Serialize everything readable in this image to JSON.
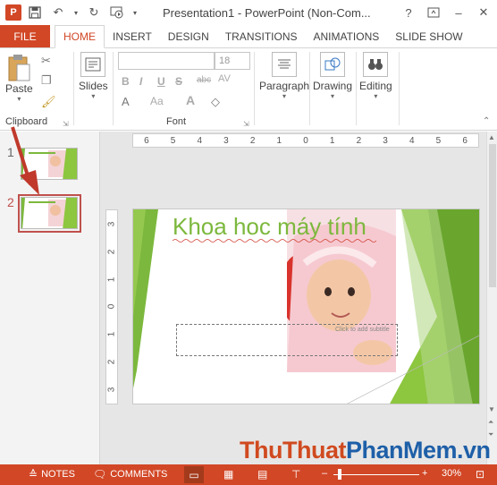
{
  "titlebar": {
    "title": "Presentation1 - PowerPoint (Non-Com...",
    "app_icon_letter": "P",
    "qat": [
      "save-icon",
      "undo-icon",
      "redo-icon",
      "start-from-beginning-icon"
    ],
    "help": "?",
    "minimize": "–",
    "close": "✕"
  },
  "tabs": [
    {
      "label": "FILE"
    },
    {
      "label": "HOME"
    },
    {
      "label": "INSERT"
    },
    {
      "label": "DESIGN"
    },
    {
      "label": "TRANSITIONS"
    },
    {
      "label": "ANIMATIONS"
    },
    {
      "label": "SLIDE SHOW"
    }
  ],
  "ribbon": {
    "clipboard": {
      "paste": "Paste",
      "group": "Clipboard"
    },
    "slides": {
      "label": "Slides"
    },
    "font": {
      "size": "18",
      "group": "Font",
      "buttons": [
        "B",
        "I",
        "U",
        "S",
        "abc",
        "AV",
        "Aa",
        "A"
      ]
    },
    "paragraph": {
      "label": "Paragraph"
    },
    "drawing": {
      "label": "Drawing"
    },
    "editing": {
      "label": "Editing"
    }
  },
  "thumbnails": [
    {
      "number": "1"
    },
    {
      "number": "2"
    }
  ],
  "rulers": {
    "horizontal": [
      "6",
      "5",
      "4",
      "3",
      "2",
      "1",
      "0",
      "1",
      "2",
      "3",
      "4",
      "5",
      "6"
    ],
    "vertical": [
      "3",
      "2",
      "1",
      "0",
      "1",
      "2",
      "3"
    ]
  },
  "slide": {
    "title": "Khoa hoc máy tính",
    "subtitle_placeholder": "Click to add subtitle"
  },
  "statusbar": {
    "notes": "NOTES",
    "comments": "COMMENTS",
    "zoom": "30%",
    "zoom_level": 30,
    "minus": "–",
    "plus": "+"
  },
  "watermark": {
    "part1": "Thu",
    "part2": "Thuat",
    "part3": "PhanMem",
    "part4": ".vn"
  },
  "colors": {
    "accent": "#d24726",
    "title_green": "#7cb83d",
    "annotation_red": "#c0504d"
  }
}
